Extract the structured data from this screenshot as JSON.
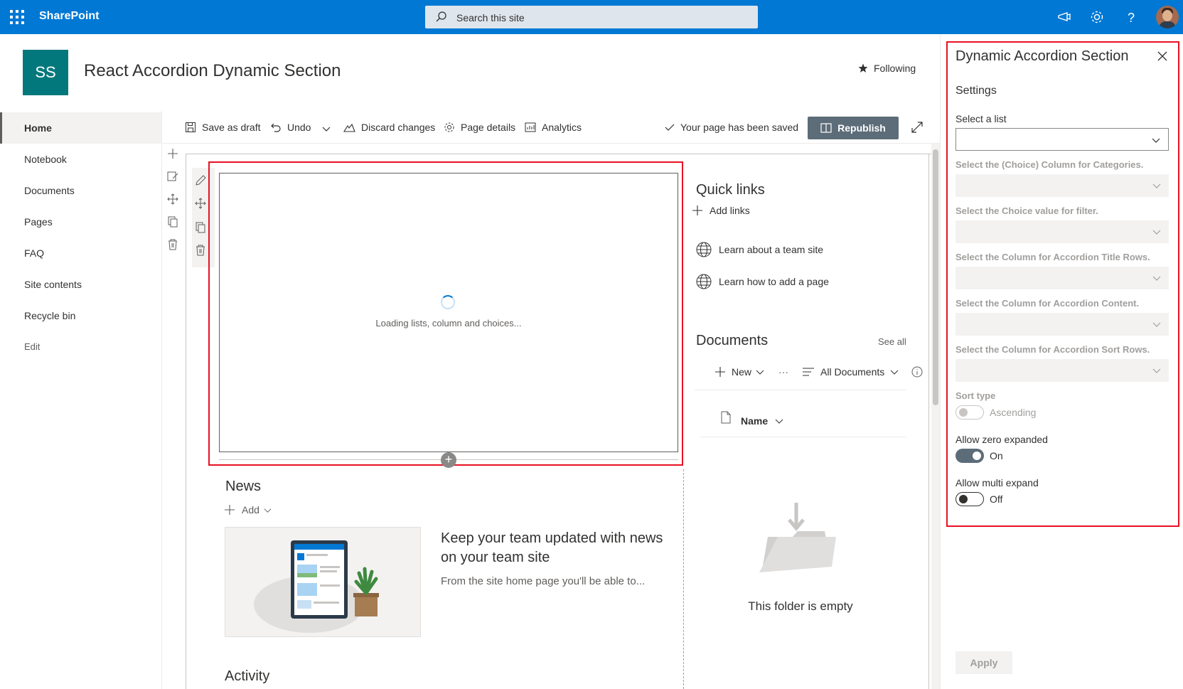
{
  "topbar": {
    "app_name": "SharePoint",
    "search_placeholder": "Search this site"
  },
  "site": {
    "logo_initials": "SS",
    "title": "React Accordion Dynamic Section",
    "following_label": "Following"
  },
  "nav": {
    "items": [
      "Home",
      "Notebook",
      "Documents",
      "Pages",
      "FAQ",
      "Site contents",
      "Recycle bin"
    ],
    "edit_label": "Edit",
    "selected": "Home"
  },
  "commandbar": {
    "save_draft": "Save as draft",
    "undo": "Undo",
    "discard": "Discard changes",
    "page_details": "Page details",
    "analytics": "Analytics",
    "saved_status": "Your page has been saved",
    "republish": "Republish"
  },
  "webpart": {
    "loading_text": "Loading lists, column and choices..."
  },
  "quick_links": {
    "title": "Quick links",
    "add_label": "Add links",
    "links": [
      "Learn about a team site",
      "Learn how to add a page"
    ]
  },
  "documents": {
    "title": "Documents",
    "see_all": "See all",
    "new_label": "New",
    "more": "···",
    "view_label": "All Documents",
    "name_header": "Name",
    "empty_text": "This folder is empty"
  },
  "news": {
    "title": "News",
    "add_label": "Add",
    "headline": "Keep your team updated with news on your team site",
    "body": "From the site home page you'll be able to..."
  },
  "activity": {
    "title": "Activity"
  },
  "panel": {
    "title": "Dynamic Accordion Section",
    "section": "Settings",
    "select_list_label": "Select a list",
    "category_label": "Select the (Choice) Column for Categories.",
    "choice_label": "Select the Choice value for filter.",
    "title_rows_label": "Select the Column for Accordion Title Rows.",
    "content_label": "Select the Column for Accordion Content.",
    "sort_rows_label": "Select the Column for Accordion Sort Rows.",
    "sort_type_label": "Sort type",
    "sort_type_value": "Ascending",
    "zero_expanded_label": "Allow zero expanded",
    "zero_expanded_value": "On",
    "multi_expand_label": "Allow multi expand",
    "multi_expand_value": "Off",
    "apply_label": "Apply"
  },
  "colors": {
    "suite_bar": "#0078d4",
    "site_logo": "#03787c",
    "republish_bg": "#5c6c79",
    "highlight": "#e81123",
    "toggle_on": "#5c6c79"
  }
}
